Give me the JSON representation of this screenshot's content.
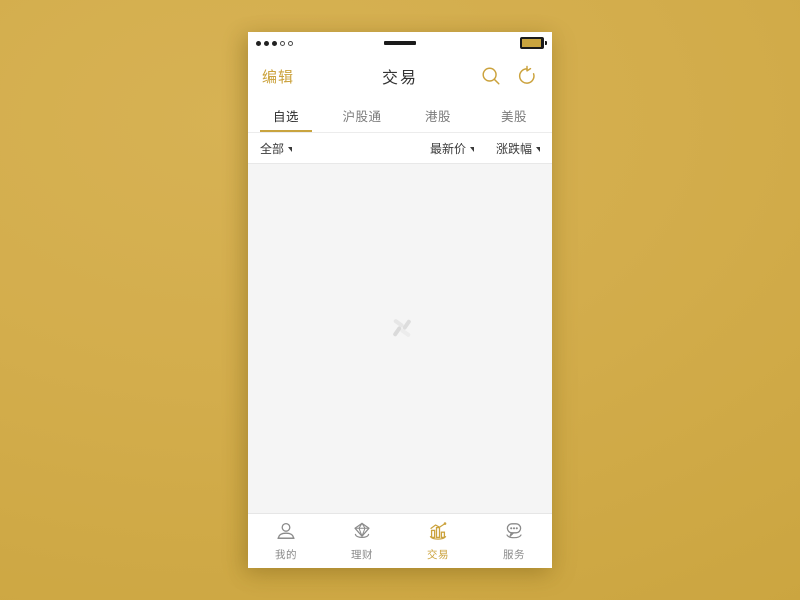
{
  "theme": {
    "background": "#d3ad4c",
    "accent": "#cba23c",
    "screen_bg": "#f5f5f5",
    "text_dark": "#2c2c2c",
    "text_muted": "#7c7c7c"
  },
  "status_bar": {
    "signal_filled": 3,
    "signal_total": 5,
    "center_indicator": "redacted-bar",
    "battery_icon": "battery-icon"
  },
  "nav": {
    "edit_label": "编辑",
    "title": "交易",
    "search_icon": "search-icon",
    "refresh_icon": "refresh-icon"
  },
  "tabs": [
    {
      "label": "自选",
      "active": true
    },
    {
      "label": "沪股通",
      "active": false
    },
    {
      "label": "港股",
      "active": false
    },
    {
      "label": "美股",
      "active": false
    }
  ],
  "filters": [
    {
      "label": "全部",
      "icon": "caret-down-icon"
    },
    {
      "label": "最新价",
      "icon": "caret-down-icon"
    },
    {
      "label": "涨跌幅",
      "icon": "caret-down-icon"
    }
  ],
  "content": {
    "state": "loading",
    "spinner_icon": "loading-spinner-icon"
  },
  "bottom_nav": [
    {
      "label": "我的",
      "icon": "person-icon",
      "active": false
    },
    {
      "label": "理财",
      "icon": "diamond-icon",
      "active": false
    },
    {
      "label": "交易",
      "icon": "bar-chart-icon",
      "active": true
    },
    {
      "label": "服务",
      "icon": "chat-bubble-icon",
      "active": false
    }
  ]
}
